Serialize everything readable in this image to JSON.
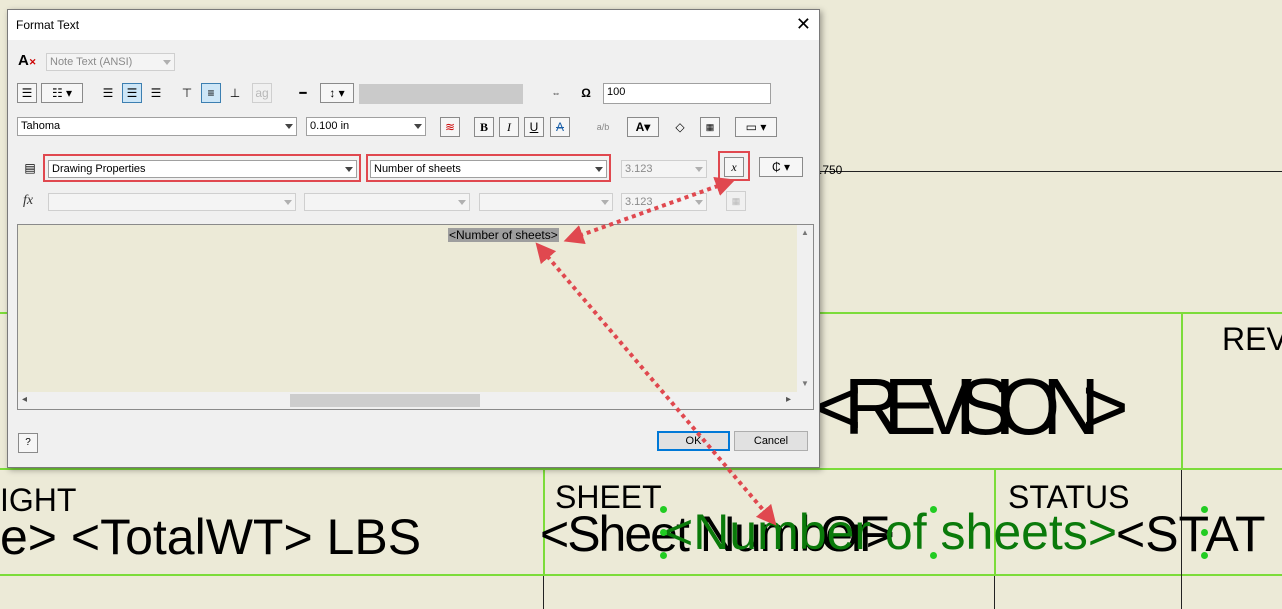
{
  "drawing": {
    "dimension": ".750",
    "rev_label": "REV",
    "revision_text": "<REVISION>",
    "weight_label": "IGHT",
    "weight_text": "e> <TotalWT> LBS",
    "sheet_label": "SHEET",
    "sheet_text": "<Sheet Number>",
    "sheet_count_text": "<Number of sheets>",
    "of_text": "OF",
    "status_label": "STATUS",
    "status_text": "<STAT"
  },
  "dialog": {
    "title": "Format Text",
    "close": "✕",
    "style": "Note Text (ANSI)",
    "font": "Tahoma",
    "font_size": "0.100 in",
    "width_scale": "100",
    "category": "Drawing Properties",
    "property": "Number of sheets",
    "precision": "3.123",
    "precision2": "3.123",
    "text_content": "<Number of sheets>",
    "ok": "OK",
    "cancel": "Cancel"
  },
  "icons": {
    "bold": "B",
    "italic": "I",
    "underline": "U",
    "strike": "A",
    "fx": "fx",
    "insert_parameter": "x",
    "symbol": "₵",
    "help": "?"
  },
  "colors": {
    "background": "#ecead7",
    "green_lines": "#7cdc3a",
    "highlight_red": "#e0484f",
    "green_text": "#0a7a0a"
  }
}
